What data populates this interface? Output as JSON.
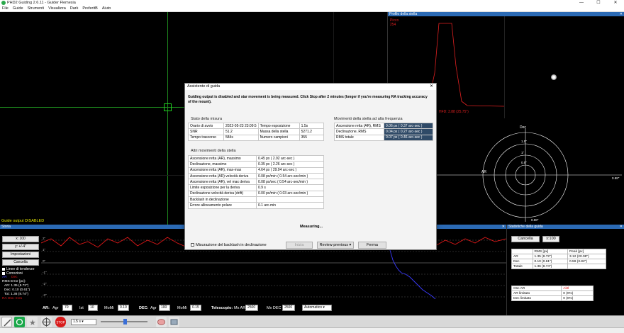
{
  "window": {
    "title": "PHD2 Guiding 2.6.11 - Guider Flemesia",
    "minimize": "—",
    "maximize": "☐",
    "close": "✕"
  },
  "menu": [
    "File",
    "Guide",
    "Strumenti",
    "Visualizza",
    "Dark",
    "PreferitB",
    "Aiuto"
  ],
  "camera": {
    "status": "Guide output DISABLED"
  },
  "profile_panel": {
    "title": "Profilo della stella",
    "peak_label": "Picco",
    "peak_value": "254",
    "hfd": "HFD: 3.88 (25.75\")"
  },
  "target_panel": {
    "title": "",
    "ra_label": "AR",
    "dec_label": "Dec",
    "ring_1": "1.5\"",
    "ring_2": "1\"",
    "ring_3": "0.5\"",
    "scale_right": "0.88\"",
    "scale_bottom": "0.88\""
  },
  "history": {
    "title": "Storia",
    "x_button": "x: 100",
    "y_button": "y: +/-4\"",
    "settings_button": "Impostazioni",
    "clear_button": "Cancella",
    "trend_lines": "Linee di tendenze",
    "corrections": "Correzioni",
    "ar_label": "AR",
    "dec_label": "Dec",
    "rms_title": "RMS Error [px]:",
    "rms_ar": "AR: 1.35 (8.72\")",
    "rms_dec": "Dec: 0.10 (0.61\")",
    "rms_tot": "Tot: 1.36 (8.74\")",
    "ra_osc": "RA Osc: 0.01",
    "y_ticks": [
      "2\"",
      "1\"",
      "0\"",
      "-1\"",
      "-2\"",
      "-3\""
    ]
  },
  "history_controls": {
    "ar": "AR:",
    "agr": "Agr",
    "ar_agr": "70",
    "ist": "Ist",
    "ar_ist": "10",
    "momi": "MoMi",
    "ar_momi": "0.10",
    "dec": "DEC:",
    "dec_agr_label": "Agr",
    "dec_agr": "100",
    "dec_momi_label": "MoMi",
    "dec_momi": "0.15",
    "telescope": "Telescopio:",
    "mx_ar_label": "Mx AR",
    "mx_ar": "2500",
    "mx_dec_label": "Mx DEC",
    "mx_dec": "2500",
    "mode": "Automatico"
  },
  "stats": {
    "title": "Statistiche della guida",
    "clear_button": "Cancella",
    "x_select": "x:100",
    "headers": [
      "",
      "RMS [px]",
      "Peak [px]"
    ],
    "rows": [
      [
        "AR",
        "1.35 (8.72\")",
        "3.12 (20.08\")"
      ],
      [
        "Dec",
        "0.10 (0.61\")",
        "0.59 (3.82\")"
      ],
      [
        "Totale",
        "1.36 (8.74\")",
        ""
      ]
    ],
    "rows2": [
      [
        "Osc AR",
        "Aktl"
      ],
      [
        "AR limitato",
        "0 (0%)"
      ],
      [
        "Dec limitato",
        "0 (0%)"
      ]
    ]
  },
  "toolbar": {
    "exposure": "1.5 s"
  },
  "dialog": {
    "title": "Assistente di guida",
    "close": "✕",
    "intro": "Guiding output is disabled and star movement is being measured.  Click Stop after 2 minutes (longer if you're measuring RA tracking accuracy of the mount).",
    "status_section": "Stato della misura",
    "status_rows": [
      [
        "Orario di avvio",
        "2022-05-23 23:09:5",
        "Tempo esposizione",
        "1.5s"
      ],
      [
        "SNR",
        "51.2",
        "Massa della stella",
        "5271.2"
      ],
      [
        "Tempo trascorso",
        "584s",
        "Numero campioni",
        "355"
      ]
    ],
    "hf_section": "Movimenti della stella ad alta frequenza",
    "hf_rows": [
      [
        "Ascensione retta (AR), RMS",
        "0.06 px ( 0.37 arc-sec )"
      ],
      [
        "Declinazione, RMS",
        "0.04 px ( 0.27 arc-sec )"
      ],
      [
        "RMS totale",
        "0.07 px ( 0.46 arc-sec )"
      ]
    ],
    "other_section": "Altri movimenti della stella",
    "other_rows": [
      [
        "Ascensione retta (AR), massimo",
        "0.45 px ( 2.92 arc-sec )"
      ],
      [
        "Declinazione, massimo",
        "0.35 px ( 2.26 arc-sec )"
      ],
      [
        "Ascensione retta (AR), max-max",
        "4.64 px ( 29.94 arc-sec )"
      ],
      [
        "Ascensione retta (AR) velocità deriva",
        "0.08 px/min ( 0.54 arc-sec/min )"
      ],
      [
        "Ascensione retta (AR), vel max deriva",
        "0.08 px/sec ( 0.54 arc-sec/min )"
      ],
      [
        "Limite esposizione per la deriva",
        "0.9 s"
      ],
      [
        "Declinazione velocità deriva (drift)",
        "0.00 px/min ( 0.03 arc-sec/min )"
      ],
      [
        "Backlash in declinazione",
        ""
      ],
      [
        "Errore allineamento polare",
        "0.1 arc-min"
      ]
    ],
    "measuring": "Measuring...",
    "backlash_checkbox": "Misurazione del backlash in declinazione",
    "start_button": "Inizia",
    "review_button": "Review previous ▾",
    "stop_button": "Ferma"
  },
  "colors": {
    "ra": "#e01818",
    "dec": "#3a3aff",
    "accent": "#2b6ab4",
    "hf_cell": "#2f4a67"
  }
}
